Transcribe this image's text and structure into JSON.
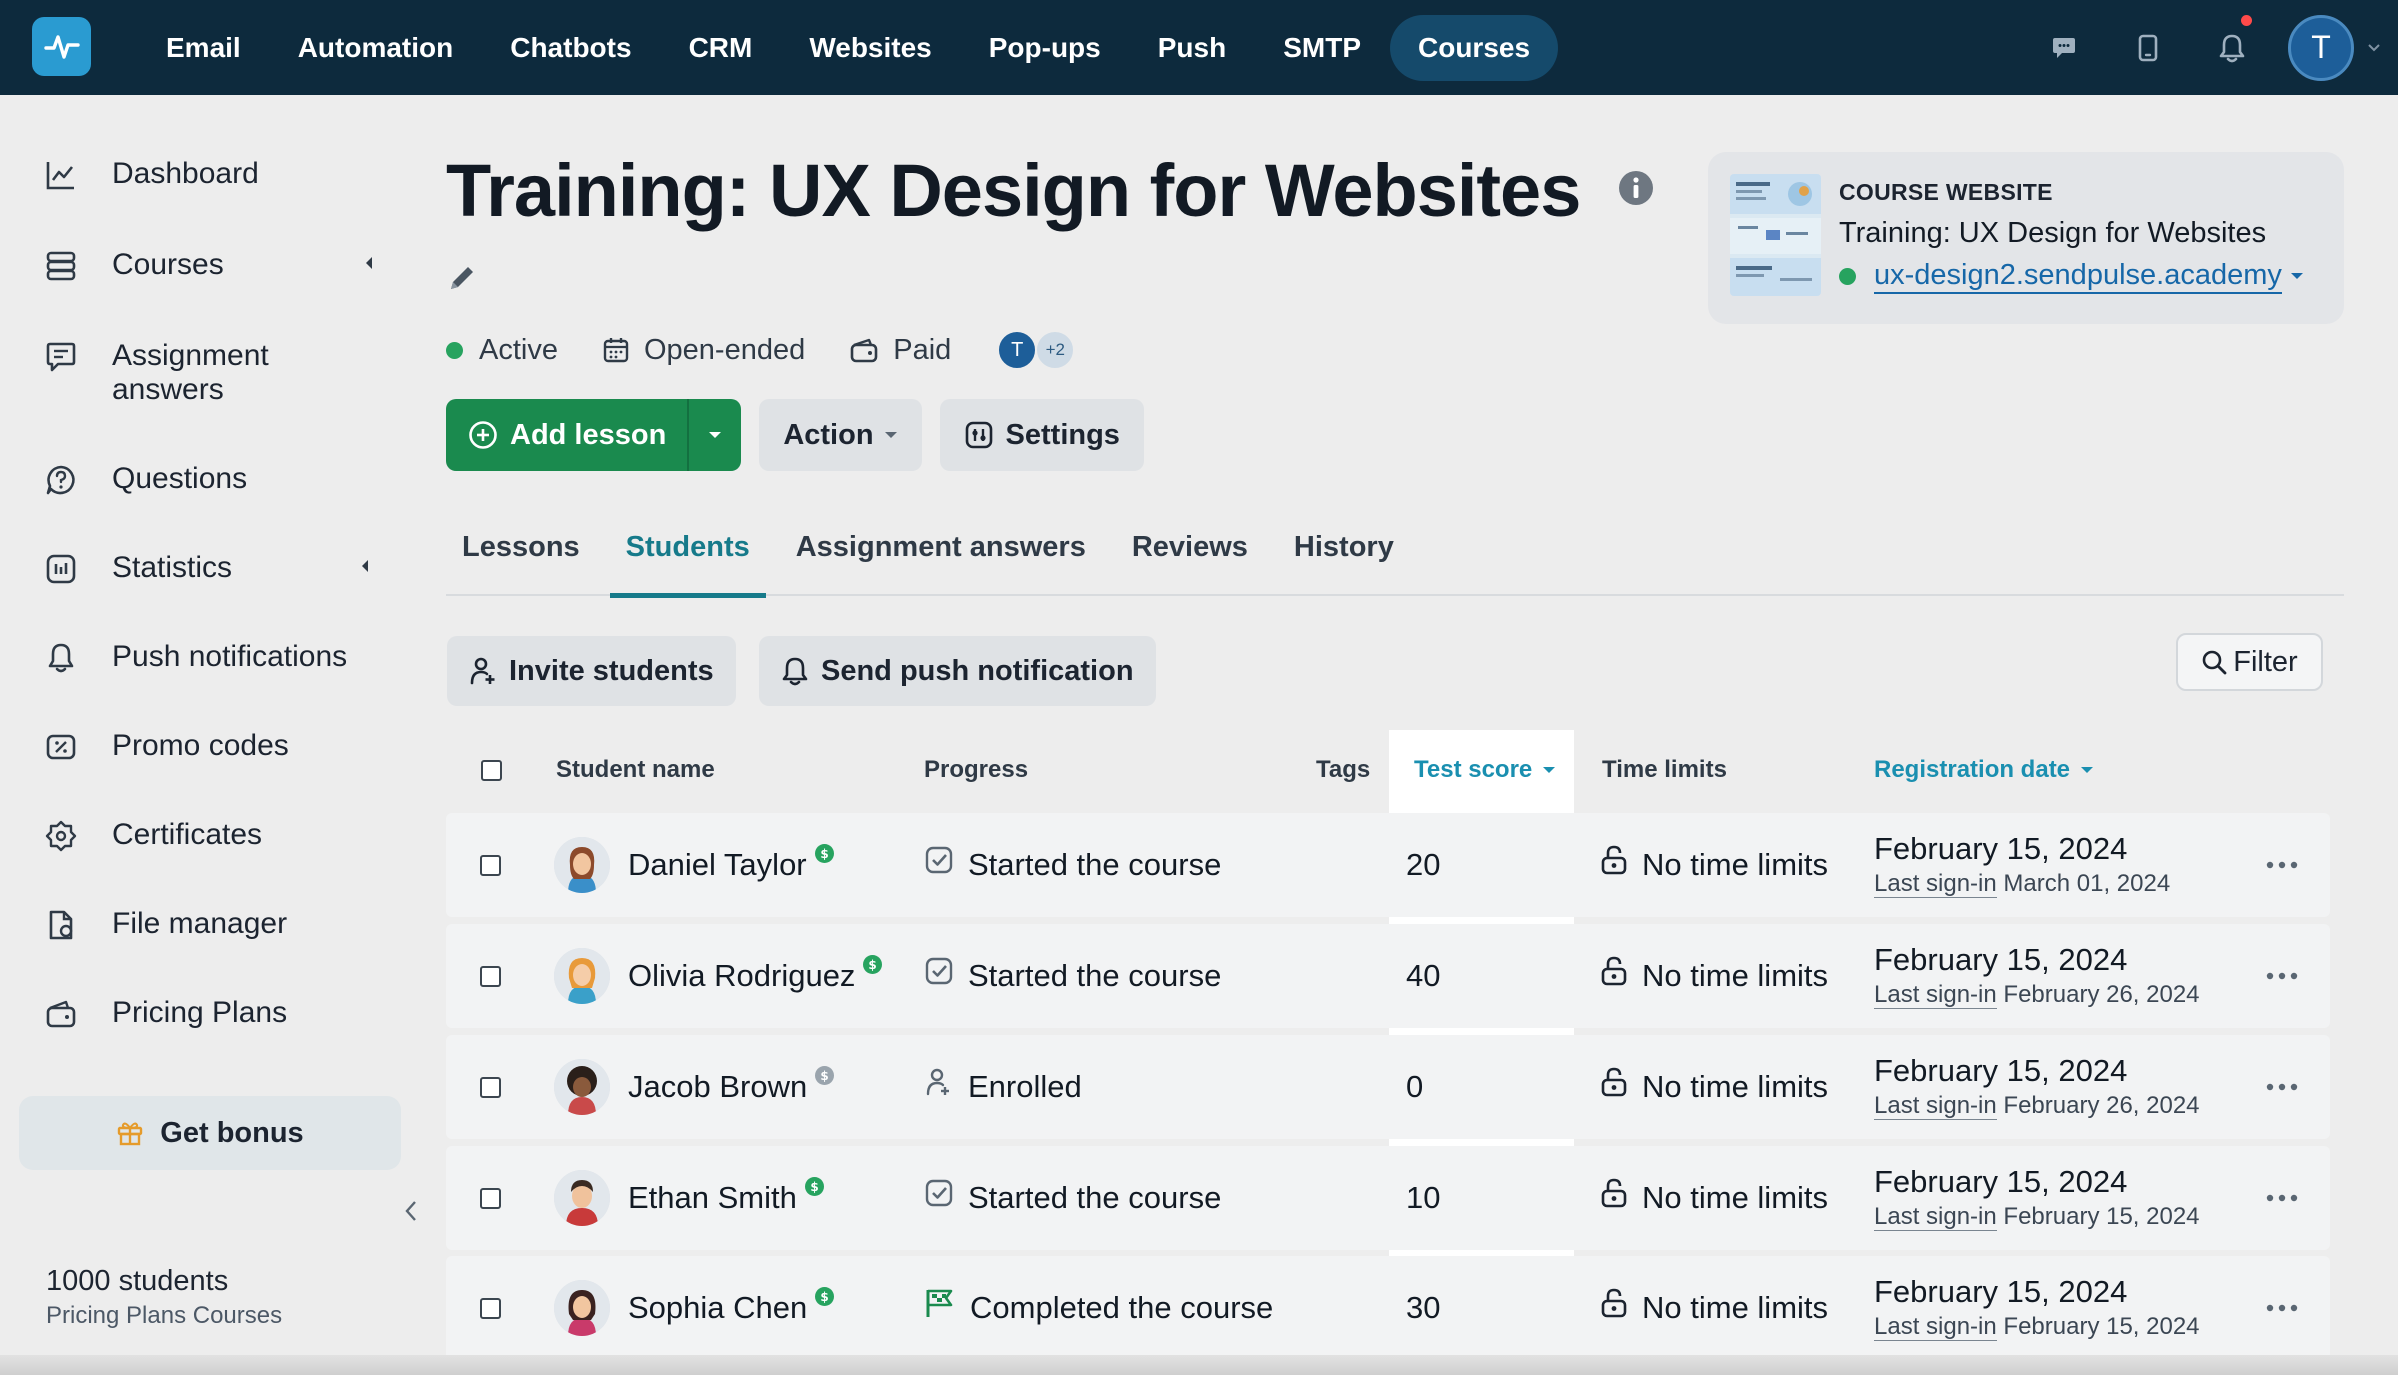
{
  "topnav": {
    "items": [
      "Email",
      "Automation",
      "Chatbots",
      "CRM",
      "Websites",
      "Pop-ups",
      "Push",
      "SMTP",
      "Courses"
    ],
    "active": "Courses",
    "avatar_initial": "T",
    "accent": "#0d2a3d"
  },
  "sidebar": {
    "items": [
      {
        "label": "Dashboard",
        "icon": "chart-line-icon"
      },
      {
        "label": "Courses",
        "icon": "layers-icon",
        "has_caret": true
      },
      {
        "label": "Assignment answers",
        "icon": "message-edit-icon"
      },
      {
        "label": "Questions",
        "icon": "question-bubble-icon"
      },
      {
        "label": "Statistics",
        "icon": "stats-icon",
        "has_caret": true
      },
      {
        "label": "Push notifications",
        "icon": "bell-icon"
      },
      {
        "label": "Promo codes",
        "icon": "promo-icon"
      },
      {
        "label": "Certificates",
        "icon": "certificate-icon"
      },
      {
        "label": "File manager",
        "icon": "file-icon"
      },
      {
        "label": "Pricing Plans",
        "icon": "wallet-icon"
      }
    ],
    "bonus_label": "Get bonus",
    "plan_count": "1000 students",
    "plan_name": "Pricing Plans Courses"
  },
  "course": {
    "title": "Training: UX Design for Websites",
    "status": "Active",
    "duration": "Open-ended",
    "pricing": "Paid",
    "member_initial": "T",
    "members_extra": "+2"
  },
  "actions": {
    "add_lesson": "Add lesson",
    "action": "Action",
    "settings": "Settings"
  },
  "website_card": {
    "label": "COURSE WEBSITE",
    "name": "Training: UX Design for Websites",
    "url": "ux-design2.sendpulse.academy"
  },
  "tabs": {
    "items": [
      "Lessons",
      "Students",
      "Assignment answers",
      "Reviews",
      "History"
    ],
    "active": "Students"
  },
  "toolbar": {
    "invite": "Invite students",
    "push": "Send push notification",
    "filter": "Filter"
  },
  "table": {
    "headers": {
      "name": "Student name",
      "progress": "Progress",
      "tags": "Tags",
      "score": "Test score",
      "limits": "Time limits",
      "reg": "Registration date"
    },
    "signin_label": "Last sign-in",
    "rows": [
      {
        "name": "Daniel Taylor",
        "paid": true,
        "progress": "Started the course",
        "progress_icon": "check-square-icon",
        "score": "20",
        "limits": "No time limits",
        "reg": "February 15, 2024",
        "signin": "March 01, 2024"
      },
      {
        "name": "Olivia Rodriguez",
        "paid": true,
        "progress": "Started the course",
        "progress_icon": "check-square-icon",
        "score": "40",
        "limits": "No time limits",
        "reg": "February 15, 2024",
        "signin": "February 26, 2024"
      },
      {
        "name": "Jacob Brown",
        "paid": false,
        "progress": "Enrolled",
        "progress_icon": "user-enrolled-icon",
        "score": "0",
        "limits": "No time limits",
        "reg": "February 15, 2024",
        "signin": "February 26, 2024"
      },
      {
        "name": "Ethan Smith",
        "paid": true,
        "progress": "Started the course",
        "progress_icon": "check-square-icon",
        "score": "10",
        "limits": "No time limits",
        "reg": "February 15, 2024",
        "signin": "February 15, 2024"
      },
      {
        "name": "Sophia Chen",
        "paid": true,
        "progress": "Completed the course",
        "progress_icon": "flag-icon",
        "score": "30",
        "limits": "No time limits",
        "reg": "February 15, 2024",
        "signin": "February 15, 2024"
      }
    ]
  }
}
